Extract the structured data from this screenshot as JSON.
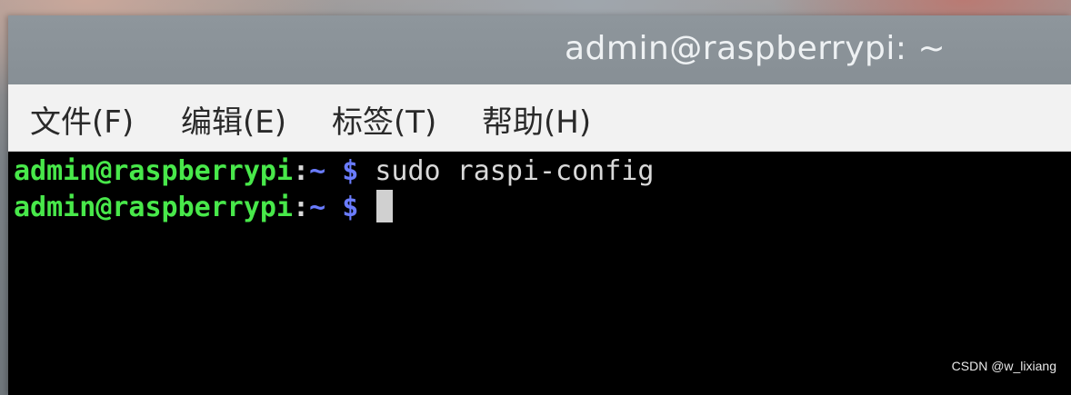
{
  "window": {
    "title": "admin@raspberrypi: ~"
  },
  "menubar": {
    "items": [
      {
        "label": "文件(F)"
      },
      {
        "label": "编辑(E)"
      },
      {
        "label": "标签(T)"
      },
      {
        "label": "帮助(H)"
      }
    ]
  },
  "terminal": {
    "lines": [
      {
        "user_host": "admin@raspberrypi",
        "sep": ":",
        "path": "~",
        "dollar": "$",
        "command": "sudo raspi-config"
      },
      {
        "user_host": "admin@raspberrypi",
        "sep": ":",
        "path": "~",
        "dollar": "$",
        "command": ""
      }
    ]
  },
  "watermark": "CSDN @w_lixiang",
  "colors": {
    "prompt_user": "#48e84a",
    "prompt_path": "#6a7cff",
    "terminal_bg": "#000000",
    "titlebar_bg": "#8b9399",
    "menubar_bg": "#f2f2f2"
  },
  "icons": {
    "resize_grip": "resize-grip-icon",
    "cursor": "block-cursor"
  }
}
